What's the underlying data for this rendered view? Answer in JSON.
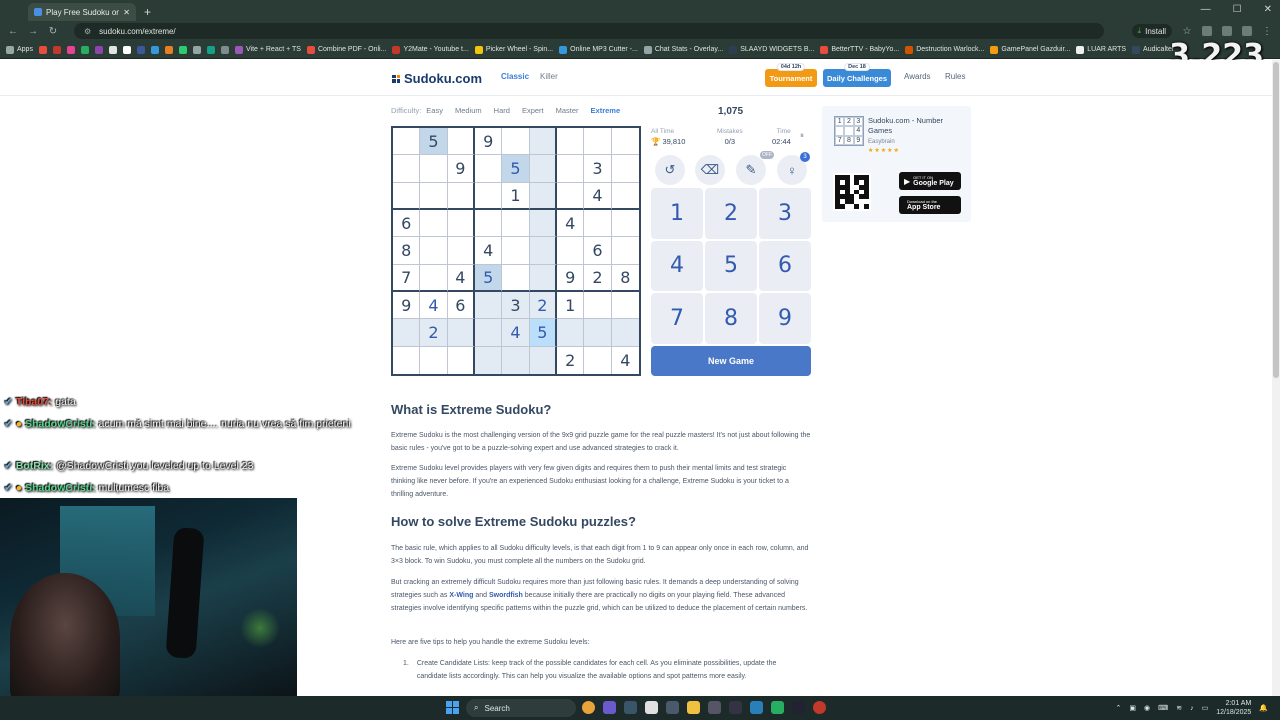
{
  "browser": {
    "tab_title": "Play Free Sudoku online - solv",
    "url": "sudoku.com/extreme/",
    "install_label": "Install",
    "bookmarks": [
      {
        "label": "Apps",
        "color": "#9aa7a2"
      },
      {
        "label": "",
        "color": "#e74c3c"
      },
      {
        "label": "",
        "color": "#c0392b"
      },
      {
        "label": "",
        "color": "#e84393"
      },
      {
        "label": "",
        "color": "#27ae60"
      },
      {
        "label": "",
        "color": "#8e44ad"
      },
      {
        "label": "",
        "color": "#dfe6e2"
      },
      {
        "label": "",
        "color": "#ffffff"
      },
      {
        "label": "",
        "color": "#3b5998"
      },
      {
        "label": "",
        "color": "#3498db"
      },
      {
        "label": "",
        "color": "#e67e22"
      },
      {
        "label": "",
        "color": "#2ecc71"
      },
      {
        "label": "",
        "color": "#95a5a6"
      },
      {
        "label": "",
        "color": "#16a085"
      },
      {
        "label": "",
        "color": "#7f8c8d"
      },
      {
        "label": "Vite + React + TS",
        "color": "#9b59b6"
      },
      {
        "label": "Combine PDF - Onli...",
        "color": "#e74c3c"
      },
      {
        "label": "Y2Mate - Youtube t...",
        "color": "#c0392b"
      },
      {
        "label": "Picker Wheel - Spin...",
        "color": "#f1c40f"
      },
      {
        "label": "Online MP3 Cutter -...",
        "color": "#3498db"
      },
      {
        "label": "Chat Stats - Overlay...",
        "color": "#95a5a6"
      },
      {
        "label": "SLAAYD WIDGETS B...",
        "color": "#2c3e50"
      },
      {
        "label": "BetterTTV - BabyYo...",
        "color": "#e74c3c"
      },
      {
        "label": "Destruction Warlock...",
        "color": "#d35400"
      },
      {
        "label": "GamePanel Gazduir...",
        "color": "#f39c12"
      },
      {
        "label": "LUAR ARTS",
        "color": "#ecf0f1"
      },
      {
        "label": "Audicalter",
        "color": "#34495e"
      }
    ]
  },
  "stream_overlay": {
    "viewer_count": "3,223"
  },
  "site": {
    "logo": "Sudoku.com",
    "nav": {
      "classic": "Classic",
      "killer": "Killer",
      "awards": "Awards",
      "rules": "Rules"
    },
    "tournament": {
      "label": "Tournament",
      "badge": "04d 12h"
    },
    "daily": {
      "label": "Daily Challenges",
      "badge": "Dec 18"
    }
  },
  "difficulty": {
    "label": "Difficulty:",
    "levels": [
      "Easy",
      "Medium",
      "Hard",
      "Expert",
      "Master",
      "Extreme"
    ],
    "active": "Extreme"
  },
  "score": "1,075",
  "stats": {
    "all_time_label": "All Time",
    "all_time_value": "39,810",
    "mistakes_label": "Mistakes",
    "mistakes_value": "0/3",
    "time_label": "Time",
    "time_value": "02:44"
  },
  "tools": {
    "undo": "undo-icon",
    "erase": "eraser-icon",
    "notes": "pencil-icon",
    "notes_state": "OFF",
    "hint": "lightbulb-icon",
    "hint_count": "3"
  },
  "grid": [
    [
      "",
      "5",
      "",
      "9",
      "",
      "",
      "",
      "",
      ""
    ],
    [
      "",
      "",
      "9",
      "",
      "5",
      "",
      "",
      "3",
      ""
    ],
    [
      "",
      "",
      "",
      "",
      "1",
      "",
      "",
      "4",
      ""
    ],
    [
      "6",
      "",
      "",
      "",
      "",
      "",
      "4",
      "",
      ""
    ],
    [
      "8",
      "",
      "",
      "4",
      "",
      "",
      "",
      "6",
      ""
    ],
    [
      "7",
      "",
      "4",
      "5",
      "",
      "",
      "9",
      "2",
      "8"
    ],
    [
      "9",
      "4",
      "6",
      "",
      "3",
      "2",
      "1",
      "",
      ""
    ],
    [
      "",
      "2",
      "",
      "",
      "4",
      "5",
      "",
      "",
      ""
    ],
    [
      "",
      "",
      "",
      "",
      "",
      "",
      "2",
      "",
      "4"
    ]
  ],
  "numpad": [
    "1",
    "2",
    "3",
    "4",
    "5",
    "6",
    "7",
    "8",
    "9"
  ],
  "new_game": "New Game",
  "app_card": {
    "name": "Sudoku.com - Number Games",
    "developer": "Easybrain",
    "stars": "★★★★★",
    "icon_digits": [
      "1",
      "2",
      "3",
      "",
      "",
      "4",
      "7",
      "8",
      "9"
    ],
    "google_play_small": "GET IT ON",
    "google_play": "Google Play",
    "app_store_small": "Download on the",
    "app_store": "App Store"
  },
  "article": {
    "h1": "What is Extreme Sudoku?",
    "p1": "Extreme Sudoku is the most challenging version of the 9x9 grid puzzle game for the real puzzle masters! It's not just about following the basic rules - you've got to be a puzzle-solving expert and use advanced strategies to crack it.",
    "p2": "Extreme Sudoku level provides players with very few given digits and requires them to push their mental limits and test strategic thinking like never before. If you're an experienced Sudoku enthusiast looking for a challenge, Extreme Sudoku is your ticket to a thrilling adventure.",
    "h2": "How to solve Extreme Sudoku puzzles?",
    "p3": "The basic rule, which applies to all Sudoku difficulty levels, is that each digit from 1 to 9 can appear only once in each row, column, and 3×3 block. To win Sudoku, you must complete all the numbers on the Sudoku grid.",
    "p4_a": "But cracking an extremely difficult Sudoku requires more than just following basic rules. It demands a deep understanding of solving strategies such as ",
    "p4_link1": "X-Wing",
    "p4_b": " and ",
    "p4_link2": "Swordfish",
    "p4_c": " because initially there are practically no digits on your playing field. These advanced strategies involve identifying specific patterns within the puzzle grid, which can be utilized to deduce the placement of certain numbers.",
    "p5": "Here are five tips to help you handle the extreme Sudoku levels:",
    "li1_num": "1.",
    "li1": "Create Candidate Lists: keep track of the possible candidates for each cell. As you eliminate possibilities, update the candidate lists accordingly. This can help you visualize the available options and spot patterns more easily."
  },
  "chat": [
    {
      "user": "Tiba07:",
      "msg": "gata"
    },
    {
      "user": "ShadowCristi:",
      "msg": "acum mă simt mai bine.... nuria nu vrea să fim prieteni"
    },
    {
      "user": "BotRix:",
      "msg": "@ShadowCristi you leveled up to Level 23"
    },
    {
      "user": "ShadowCristi:",
      "msg": "mulțumesc fiba"
    }
  ],
  "taskbar": {
    "search": "Search",
    "time": "2:01 AM",
    "date": "12/18/2025"
  }
}
